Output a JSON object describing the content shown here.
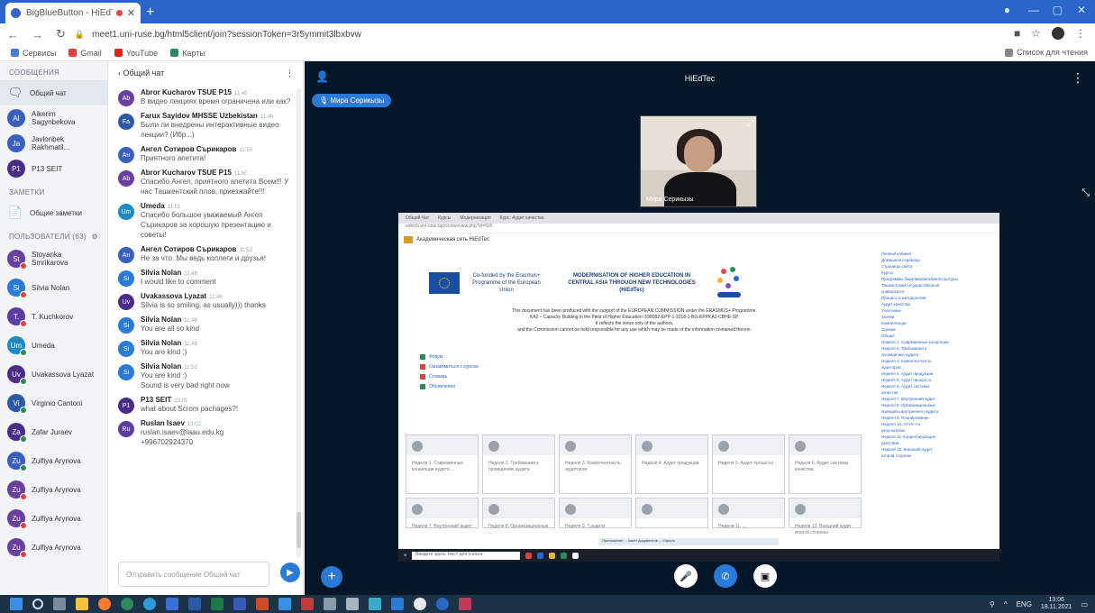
{
  "browser": {
    "tab_title": "BigBlueButton - HiEdTec",
    "tab_close": "✕",
    "new_tab": "+",
    "url": "meet1.uni-ruse.bg/html5client/join?sessionToken=3r5ymmit3lbxbvw",
    "bookmarks": [
      "Сервисы",
      "Gmail",
      "YouTube",
      "Карты"
    ],
    "reading_list": "Список для чтения"
  },
  "sidebar": {
    "messages_label": "СООБЩЕНИЯ",
    "public_chat": "Общий чат",
    "private_chats": [
      {
        "initials": "AI",
        "name": "Aikerim Sagynbekova",
        "color": "#3b5fc0"
      },
      {
        "initials": "Ja",
        "name": "Javlonbek Rakhmatil...",
        "color": "#3b5fc0"
      },
      {
        "initials": "P1",
        "name": "P13 SEIT",
        "color": "#4a2d8a"
      }
    ],
    "notes_label": "ЗАМЕТКИ",
    "shared_notes": "Общие заметки",
    "users_label": "ПОЛЬЗОВАТЕЛИ (63)",
    "users": [
      {
        "initials": "St",
        "name": "Stoyanka Smrikarova",
        "color": "#6b3fa0",
        "dot": "#d9443c"
      },
      {
        "initials": "Si",
        "name": "Silvia Nolan",
        "color": "#2a7ad8",
        "dot": "#d9443c"
      },
      {
        "initials": "T.",
        "name": "T. Kuchkorov",
        "color": "#5b3fa0",
        "dot": "#d9443c"
      },
      {
        "initials": "Um",
        "name": "Umeda",
        "color": "#1d8ac4",
        "dot": "#2a8a5a"
      },
      {
        "initials": "Uv",
        "name": "Uvakassova Lyazat",
        "color": "#4a2d8a",
        "dot": "#2a8a5a"
      },
      {
        "initials": "Vi",
        "name": "Virginio Cantoni",
        "color": "#2d5aa8",
        "dot": "#2a8a5a"
      },
      {
        "initials": "Za",
        "name": "Zafar Juraev",
        "color": "#4a2d8a",
        "dot": "#2a8a5a"
      },
      {
        "initials": "Zu",
        "name": "Zulfiya Arynova",
        "color": "#3b5fc0",
        "dot": "#2a8a5a"
      },
      {
        "initials": "Zu",
        "name": "Zulfiya Arynova",
        "color": "#6b3fa0",
        "dot": "#d9443c"
      },
      {
        "initials": "Zu",
        "name": "Zulfiya Arynova",
        "color": "#6b3fa0",
        "dot": "#d9443c"
      },
      {
        "initials": "Zu",
        "name": "Zulfiya Arynova",
        "color": "#6b3fa0",
        "dot": "#d9443c"
      }
    ]
  },
  "chat": {
    "back_title": "Общий чат",
    "placeholder": "Отправить сообщение Общий чат",
    "messages": [
      {
        "initials": "Ab",
        "color": "#6b3fa0",
        "name": "Abror Kucharov TSUE P15",
        "time": "11:46",
        "text": "В видео лекциях время ограничена или как?"
      },
      {
        "initials": "Fa",
        "color": "#2d5aa8",
        "name": "Farux Sayidov MHSSE Uzbekistan",
        "time": "11:46",
        "text": "Были ли внедрены интерактивные видео лекции? (Ибр...)"
      },
      {
        "initials": "Ан",
        "color": "#3b5fc0",
        "name": "Ангел Сотиров Сърикаров",
        "time": "11:50",
        "text": "Приятного апетита!"
      },
      {
        "initials": "Ab",
        "color": "#6b3fa0",
        "name": "Abror Kucharov TSUE P15",
        "time": "11:50",
        "text": "Спасибо Ангел, приятного апетита Всем!!! У нас Ташкентский плов, приезжайте!!!"
      },
      {
        "initials": "Um",
        "color": "#1d8ac4",
        "name": "Umeda",
        "time": "11:51",
        "text": "Спасибо большое уважаемый Ангел Сърикаров за хорошую презентацию и советы!"
      },
      {
        "initials": "Ан",
        "color": "#3b5fc0",
        "name": "Ангел Сотиров Сърикаров",
        "time": "11:52",
        "text": "Не за что. Мы ведь коллеги и друзья!"
      },
      {
        "initials": "Si",
        "color": "#2a7ad8",
        "name": "Silvia Nolan",
        "time": "11:46",
        "text": "I would like to comment"
      },
      {
        "initials": "Uv",
        "color": "#4a2d8a",
        "name": "Uvakassova Lyazat",
        "time": "11:46",
        "text": "Silvia is so smiling, as usually))) thanks"
      },
      {
        "initials": "Si",
        "color": "#2a7ad8",
        "name": "Silvia Nolan",
        "time": "11:48",
        "text": "You are all so kind"
      },
      {
        "initials": "Si",
        "color": "#2a7ad8",
        "name": "Silvia Nolan",
        "time": "11:49",
        "text": "You are kind :)"
      },
      {
        "initials": "Si",
        "color": "#2a7ad8",
        "name": "Silvia Nolan",
        "time": "11:52",
        "text": "You are kind :)",
        "extra": "Sound is very bad right now"
      },
      {
        "initials": "P1",
        "color": "#4a2d8a",
        "name": "P13 SEIT",
        "time": "13:01",
        "text": "what about Scrom pachages?!"
      },
      {
        "initials": "Ru",
        "color": "#5b3fa0",
        "name": "Ruslan Isaev",
        "time": "13:02",
        "text": "ruslan.isaev@iaau.edu.kg",
        "extra": "+996702924370"
      }
    ]
  },
  "meeting": {
    "title": "HiEdTec",
    "talking": "Мира Серикызы",
    "webcam_name": "Мира Серикызы"
  },
  "share": {
    "tabs": [
      "Общий Чат",
      "Курсы",
      "Модернизация",
      "Курс: Аудит качества"
    ],
    "url": "edtech.uni-ruse.bg/course/view.php?id=505",
    "site": "Академическая сеть HiEdTec",
    "cofunded": "Co-funded by the Erasmus+ Programme of the European Union",
    "project": "MODERNISATION OF HIGHER EDUCATION IN CENTRAL ASIA THROUGH NEW TECHNOLOGIES (HiEdTec)",
    "disclaimer_1": "This document has been produced with the support of the EUROPEAN COMMISSION under the ERASMUS+ Programme.",
    "disclaimer_2": "KA2 – Capacity Building in the Field of Higher Education: 598092-EPP-1-2018-1-BG-EPPKA2-CBHE-SP.",
    "disclaimer_3": "It reflects the views only of the authors,",
    "disclaimer_4": "and the Commission cannot be held responsible for any use which may be made of the information contained therein.",
    "links": [
      "Форум",
      "Ознакомиться с курсом",
      "Словарь",
      "Объявления"
    ],
    "cards": [
      "Неделя 1. Современные концепции аудита ...",
      "Неделя 2. Требования к проведению аудита",
      "Неделя 3. Компетентность аудиторов",
      "Неделя 4. Аудит продукции",
      "Неделя 5. Аудит процесса",
      "Неделя 6. Аудит системы качества",
      "Неделя 7. Внутренний аудит",
      "Неделя 8. Организационные ...",
      "Неделя 9. Т.аудита",
      "",
      "Неделя 11. ...",
      "Неделя 12. Внешний аудит второй стороны"
    ],
    "side_items": [
      "Личный кабинет",
      "Домашняя страница",
      "Страницы сайта",
      "Курсы",
      "Программы бакалавриата/магистратуры",
      "Ташкентский государственный",
      "университет",
      "Процесс и методология",
      "Аудит качества",
      "Участники",
      "Значки",
      "Компетенции",
      "Оценки",
      "Общее",
      "Неделя 1. Современные концепции",
      "Неделя 2. Требования к",
      "проведению аудита",
      "Неделя 3. Компетентность",
      "аудиторов",
      "Неделя 4. Аудит продукции",
      "Неделя 5. Аудит процесса",
      "Неделя 6. Аудит системы",
      "качества",
      "Неделя 7. Внутренний аудит",
      "Неделя 8. Организационные",
      "принципы внутреннего аудита",
      "Неделя 9. Планирование",
      "Неделя 10. Отчёт по",
      "результатам",
      "Неделя 11. Корректирующие",
      "действия",
      "Неделя 12. Внешний аудит",
      "второй стороны"
    ],
    "search": "Введите здесь текст для поиска",
    "popup": "Приложение ... пакет документов ... Скрыть"
  },
  "taskbar": {
    "lang": "ENG",
    "time": "13:06",
    "date": "18.11.2021"
  }
}
